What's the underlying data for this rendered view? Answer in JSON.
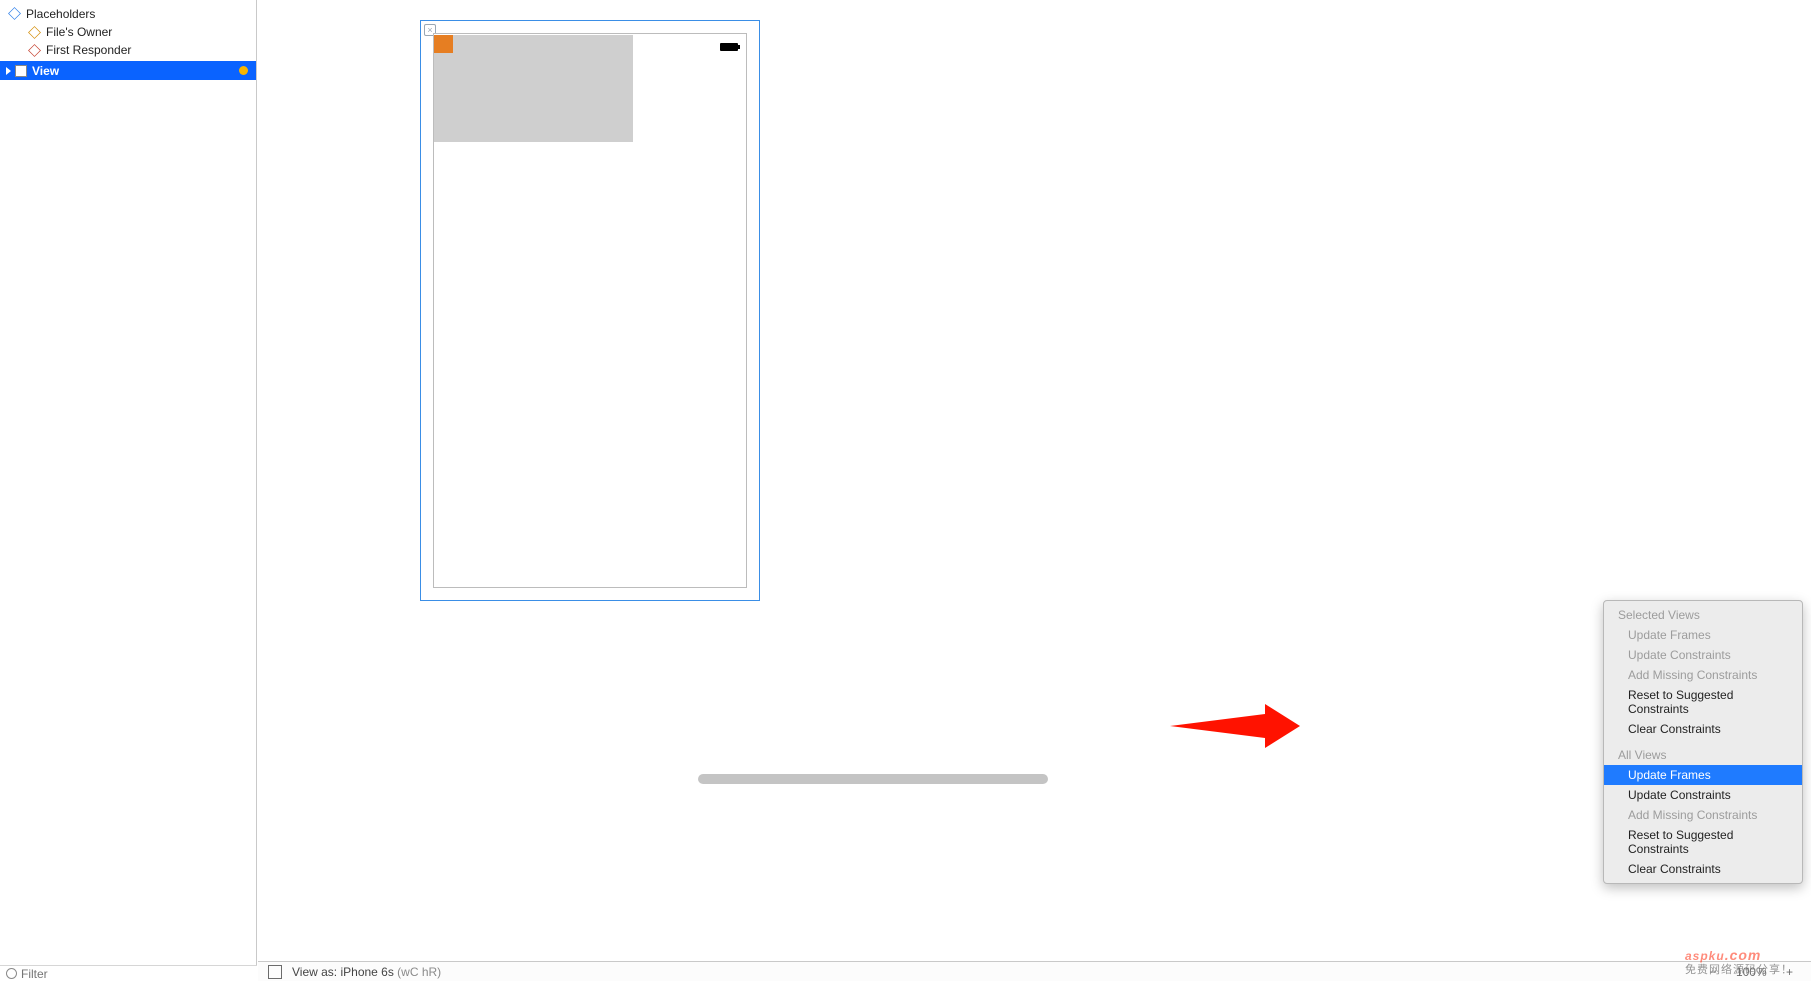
{
  "sidebar": {
    "placeholders_label": "Placeholders",
    "files_owner_label": "File's Owner",
    "first_responder_label": "First Responder",
    "view_label": "View"
  },
  "filter": {
    "placeholder": "Filter"
  },
  "bottom": {
    "view_as_prefix": "View as: ",
    "device": "iPhone 6s",
    "size_class": " (wC hR)",
    "zoom": "100%"
  },
  "context_menu": {
    "header_selected": "Selected Views",
    "sel_update_frames": "Update Frames",
    "sel_update_constraints": "Update Constraints",
    "sel_add_missing": "Add Missing Constraints",
    "sel_reset": "Reset to Suggested Constraints",
    "sel_clear": "Clear Constraints",
    "header_all": "All Views",
    "all_update_frames": "Update Frames",
    "all_update_constraints": "Update Constraints",
    "all_add_missing": "Add Missing Constraints",
    "all_reset": "Reset to Suggested Constraints",
    "all_clear": "Clear Constraints"
  },
  "watermark": {
    "brand": "aspku",
    "suffix": ".com",
    "tagline": "免费网络源码分享！"
  }
}
